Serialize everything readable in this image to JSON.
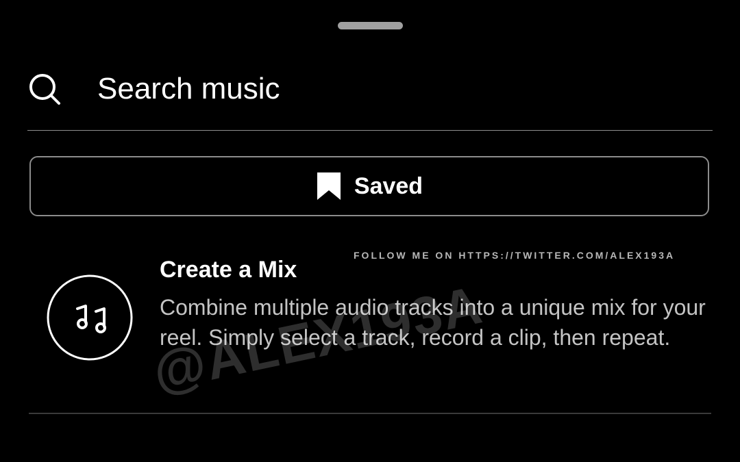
{
  "search": {
    "placeholder": "Search music",
    "icon": "search-icon"
  },
  "saved": {
    "label": "Saved",
    "icon": "bookmark-icon"
  },
  "create_mix": {
    "title": "Create a Mix",
    "description": "Combine multiple audio tracks into a unique mix for your reel. Simply select a track, record a clip, then repeat.",
    "icon": "music-notes-icon"
  },
  "watermark": {
    "follow_text": "FOLLOW ME ON HTTPS://TWITTER.COM/ALEX193A",
    "handle": "@ALEX193A"
  },
  "colors": {
    "background": "#000000",
    "text_primary": "#ffffff",
    "text_secondary": "#c4c4c4",
    "border": "#8c8c8c"
  }
}
